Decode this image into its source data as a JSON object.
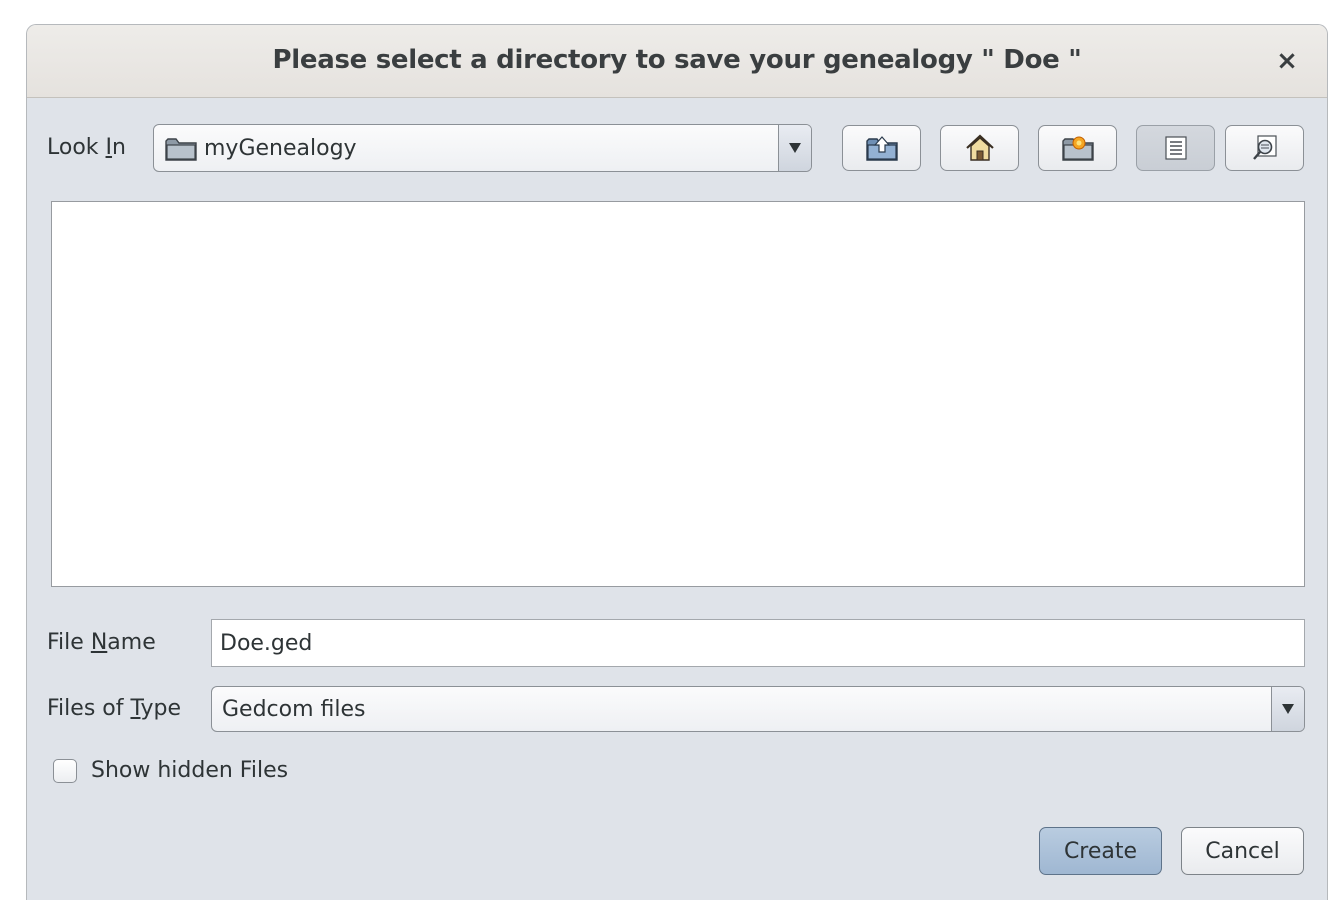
{
  "dialog": {
    "title": "Please select a directory to save your genealogy \" Doe \"",
    "close_glyph": "×"
  },
  "look_in": {
    "label_prefix": "Look ",
    "label_mnemonic": "I",
    "label_suffix": "n",
    "value": "myGenealogy",
    "icon": "folder-icon"
  },
  "toolbar": {
    "buttons": [
      {
        "name": "up-one-level-button",
        "icon": "folder-up-icon"
      },
      {
        "name": "home-button",
        "icon": "home-icon"
      },
      {
        "name": "new-folder-button",
        "icon": "new-folder-icon"
      },
      {
        "name": "list-view-button",
        "icon": "list-view-icon",
        "pressed": true
      },
      {
        "name": "details-view-button",
        "icon": "details-view-icon"
      }
    ]
  },
  "file_list": {
    "items": []
  },
  "file_name": {
    "label_prefix": "File ",
    "label_mnemonic": "N",
    "label_suffix": "ame",
    "value": "Doe.ged"
  },
  "files_of_type": {
    "label_prefix": "Files of ",
    "label_mnemonic": "T",
    "label_suffix": "ype",
    "value": "Gedcom files"
  },
  "show_hidden": {
    "label": "Show hidden Files",
    "checked": false
  },
  "buttons": {
    "create_label": "Create",
    "cancel_label": "Cancel"
  }
}
